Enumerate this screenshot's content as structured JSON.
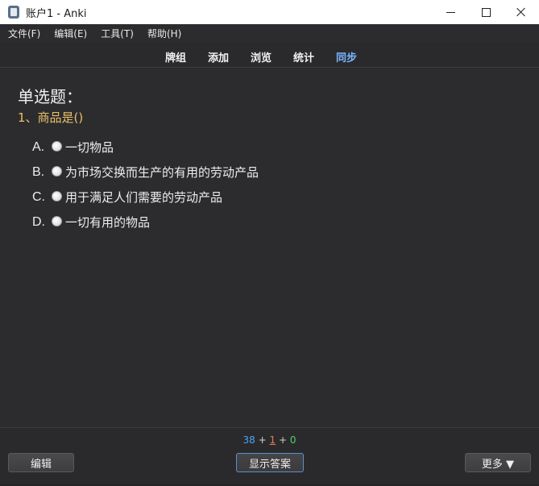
{
  "window": {
    "title": "账户1 - Anki",
    "app_icon": "anki-icon",
    "controls": [
      "minimize-icon",
      "maximize-icon",
      "close-icon"
    ]
  },
  "menu": [
    {
      "label": "文件(F)"
    },
    {
      "label": "编辑(E)"
    },
    {
      "label": "工具(T)"
    },
    {
      "label": "帮助(H)"
    }
  ],
  "toolbar": [
    {
      "label": "牌组"
    },
    {
      "label": "添加"
    },
    {
      "label": "浏览"
    },
    {
      "label": "统计"
    },
    {
      "label": "同步",
      "active": true
    }
  ],
  "card": {
    "heading": "单选题：",
    "question": "1、商品是()",
    "options": [
      {
        "letter": "A.",
        "text": "一切物品"
      },
      {
        "letter": "B.",
        "text": "为市场交换而生产的有用的劳动产品"
      },
      {
        "letter": "C.",
        "text": "用于满足人们需要的劳动产品"
      },
      {
        "letter": "D.",
        "text": "一切有用的物品"
      }
    ]
  },
  "counts": {
    "new": "38",
    "learn": "1",
    "review": "0",
    "sep": "+"
  },
  "bottom": {
    "edit_label": "编辑",
    "show_answer_label": "显示答案",
    "more_label": "更多 ▼"
  },
  "colors": {
    "background": "#2c2c2e",
    "accent": "#7cb6ff",
    "question": "#e8c066",
    "new": "#4aa3ff",
    "learn": "#e07b5d",
    "review": "#4fd06a"
  }
}
